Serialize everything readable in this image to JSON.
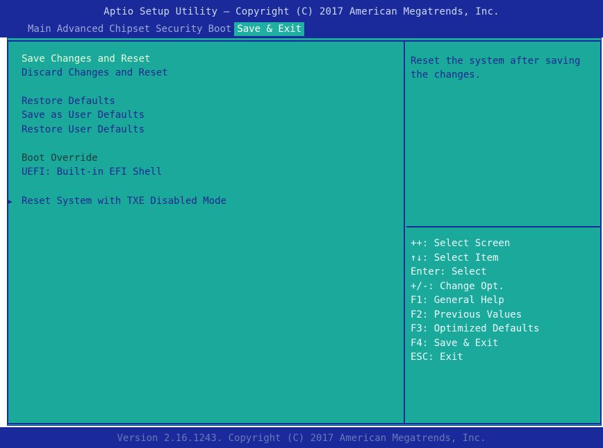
{
  "header": {
    "title": "Aptio Setup Utility – Copyright (C) 2017 American Megatrends, Inc."
  },
  "tabs": [
    {
      "label": "Main"
    },
    {
      "label": "Advanced"
    },
    {
      "label": "Chipset"
    },
    {
      "label": "Security"
    },
    {
      "label": "Boot"
    },
    {
      "label": "Save & Exit"
    }
  ],
  "active_tab": "Save & Exit",
  "menu": {
    "save_changes_reset": "Save Changes and Reset",
    "discard_changes_reset": "Discard Changes and Reset",
    "restore_defaults": "Restore Defaults",
    "save_user_defaults": "Save as User Defaults",
    "restore_user_defaults": "Restore User Defaults",
    "boot_override": "Boot Override",
    "uefi_shell": "UEFI: Built-in EFI Shell",
    "reset_txe": "Reset System with TXE Disabled Mode"
  },
  "help": {
    "description": "Reset the system after saving the changes."
  },
  "keys": [
    "++: Select Screen",
    "↑↓: Select Item",
    "Enter: Select",
    "+/-: Change Opt.",
    "F1: General Help",
    "F2: Previous Values",
    "F3: Optimized Defaults",
    "F4: Save & Exit",
    "ESC: Exit"
  ],
  "footer": {
    "text": "Version 2.16.1243. Copyright (C) 2017 American Megatrends, Inc."
  },
  "colors": {
    "header_bg": "#1a2a9a",
    "panel_bg": "#1aa99b",
    "item_text": "#1b2890",
    "selected_text": "#e8ffd8",
    "key_text": "#eaffff"
  }
}
